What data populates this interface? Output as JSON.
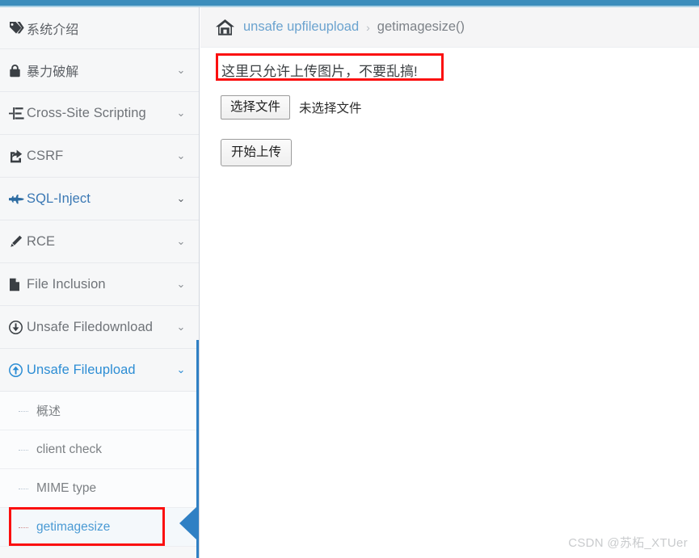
{
  "theme": {
    "topbar_color": "#3c8dbc",
    "accent_blue": "#2c8dd4",
    "annotation_red": "#fb0f0f",
    "sidebar_bg": "#f6f7f8"
  },
  "sidebar": {
    "items": [
      {
        "label": "系统介绍",
        "icon": "tag-icon",
        "caret": "",
        "state": "cjk"
      },
      {
        "label": "暴力破解",
        "icon": "lock-icon",
        "caret": "⌄",
        "state": "cjk"
      },
      {
        "label": "Cross-Site Scripting",
        "icon": "list-tree-icon",
        "caret": "⌄",
        "state": ""
      },
      {
        "label": "CSRF",
        "icon": "share-icon",
        "caret": "⌄",
        "state": ""
      },
      {
        "label": "SQL-Inject",
        "icon": "plane-icon",
        "caret": "⌄",
        "state": "link"
      },
      {
        "label": "RCE",
        "icon": "pencil-icon",
        "caret": "⌄",
        "state": ""
      },
      {
        "label": "File Inclusion",
        "icon": "file-icon",
        "caret": "⌄",
        "state": ""
      },
      {
        "label": "Unsafe Filedownload",
        "icon": "download-circle-icon",
        "caret": "⌄",
        "state": ""
      },
      {
        "label": "Unsafe Fileupload",
        "icon": "upload-circle-icon",
        "caret": "⌄",
        "state": "active"
      }
    ],
    "subitems": [
      {
        "label": "概述",
        "selected": false,
        "cjk": true
      },
      {
        "label": "client check",
        "selected": false,
        "cjk": false
      },
      {
        "label": "MIME type",
        "selected": false,
        "cjk": false
      },
      {
        "label": "getimagesize",
        "selected": true,
        "cjk": false
      }
    ]
  },
  "breadcrumb": {
    "home_icon": "home-icon",
    "link": "unsafe upfileupload",
    "separator": "›",
    "current": "getimagesize()"
  },
  "main": {
    "notice": "这里只允许上传图片，不要乱搞!",
    "choose_file_label": "选择文件",
    "file_status": "未选择文件",
    "submit_label": "开始上传"
  },
  "watermark": "CSDN @苏柘_XTUer"
}
